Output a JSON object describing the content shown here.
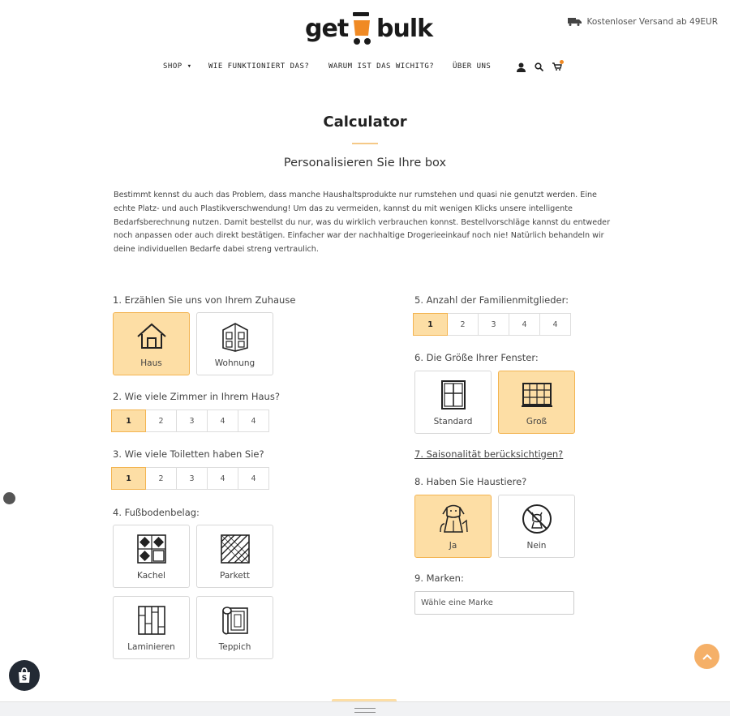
{
  "header": {
    "logo_left": "get",
    "logo_right": "bulk",
    "shipping_text": "Kostenloser Versand ab 49EUR"
  },
  "nav": {
    "items": [
      "SHOP ▾",
      "WIE FUNKTIONIERT DAS?",
      "WARUM IST DAS WICHITG?",
      "ÜBER UNS"
    ],
    "icons": [
      "user-icon",
      "search-icon",
      "cart-icon"
    ]
  },
  "page": {
    "title": "Calculator",
    "subtitle": "Personalisieren Sie Ihre box",
    "intro": "Bestimmt kennst du auch das Problem, dass manche Haushaltsprodukte nur rumstehen und quasi nie genutzt werden. Eine echte Platz- und auch Plastikverschwendung! Um das zu vermeiden, kannst du mit wenigen Klicks unsere intelligente Bedarfsberechnung nutzen. Damit bestellst du nur, was du wirklich verbrauchen konnst. Bestellvorschläge kannst du entweder noch anpassen oder auch direkt bestätigen. Einfacher war der nachhaltige Drogerieeinkauf noch nie! Natürlich behandeln wir deine individuellen Bedarfe dabei streng vertraulich."
  },
  "questions": {
    "q1": {
      "label": "1. Erzählen Sie uns von Ihrem Zuhause",
      "options": [
        "Haus",
        "Wohnung"
      ],
      "selected": "Haus"
    },
    "q2": {
      "label": "2. Wie viele Zimmer in Ihrem Haus?",
      "options": [
        "1",
        "2",
        "3",
        "4",
        "4"
      ],
      "selected": "1"
    },
    "q3": {
      "label": "3. Wie viele Toiletten haben Sie?",
      "options": [
        "1",
        "2",
        "3",
        "4",
        "4"
      ],
      "selected": "1"
    },
    "q4": {
      "label": "4. Fußbodenbelag:",
      "options": [
        "Kachel",
        "Parkett",
        "Laminieren",
        "Teppich"
      ]
    },
    "q5": {
      "label": "5. Anzahl der Familienmitglieder:",
      "options": [
        "1",
        "2",
        "3",
        "4",
        "4"
      ],
      "selected": "1"
    },
    "q6": {
      "label": "6. Die Größe Ihrer Fenster:",
      "options": [
        "Standard",
        "Groß"
      ],
      "selected": "Groß"
    },
    "q7": {
      "label": "7. Saisonalität berücksichtigen?"
    },
    "q8": {
      "label": "8. Haben Sie Haustiere?",
      "options": [
        "Ja",
        "Nein"
      ],
      "selected": "Ja"
    },
    "q9": {
      "label": "9. Marken:",
      "placeholder": "Wähle eine Marke"
    }
  },
  "colors": {
    "accent": "#fddea5",
    "accent_border": "#f3b451",
    "logo_orange": "#f08a24",
    "scroll_button": "#f5b068"
  }
}
